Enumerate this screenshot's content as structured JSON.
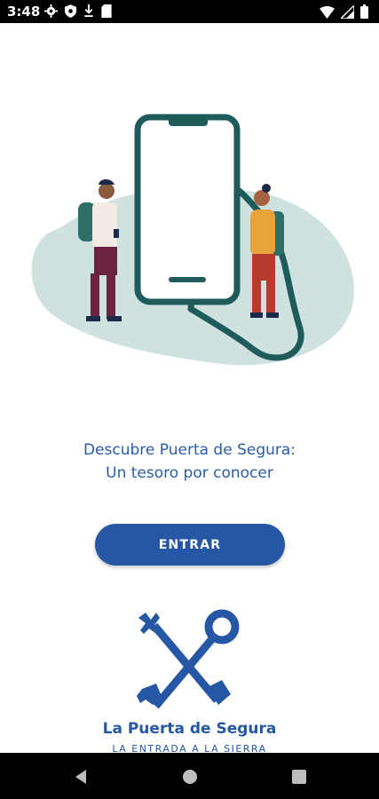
{
  "status_bar": {
    "time": "3:48",
    "left_icons": [
      "gear-icon",
      "shield-icon",
      "download-arrow-icon",
      "sd-card-icon"
    ],
    "right_icons": [
      "wifi-icon",
      "cell-signal-icon",
      "battery-icon"
    ]
  },
  "main": {
    "tagline_line1": "Descubre Puerta de Segura:",
    "tagline_line2": "Un tesoro por conocer",
    "enter_button_label": "ENTRAR"
  },
  "logo": {
    "title": "La Puerta de Segura",
    "subtitle": "LA ENTRADA A LA SIERRA"
  },
  "nav_bar": {
    "buttons": [
      "back-icon",
      "home-icon",
      "recents-icon"
    ]
  },
  "colors": {
    "primary": "#2557a5",
    "text_blue": "#2a5ca8",
    "illustration_teal": "#1f5b5a",
    "illustration_blob": "#cfe2e0"
  }
}
